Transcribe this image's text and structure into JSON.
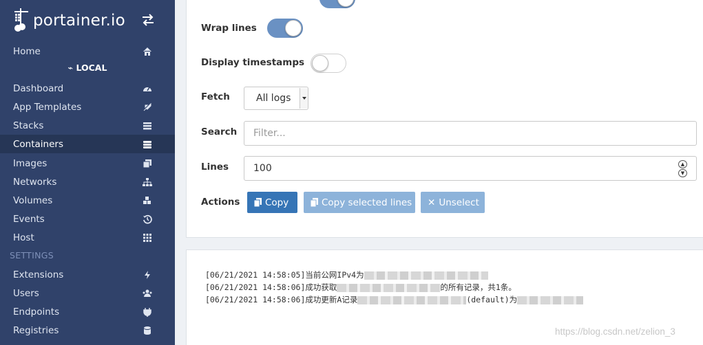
{
  "app": {
    "name": "portainer.io"
  },
  "sidebar": {
    "home": "Home",
    "endpoint": "LOCAL",
    "items": [
      {
        "label": "Dashboard",
        "icon": "tachometer-icon"
      },
      {
        "label": "App Templates",
        "icon": "rocket-icon"
      },
      {
        "label": "Stacks",
        "icon": "list-icon"
      },
      {
        "label": "Containers",
        "icon": "server-icon",
        "active": true
      },
      {
        "label": "Images",
        "icon": "clone-icon"
      },
      {
        "label": "Networks",
        "icon": "sitemap-icon"
      },
      {
        "label": "Volumes",
        "icon": "cubes-icon"
      },
      {
        "label": "Events",
        "icon": "history-icon"
      },
      {
        "label": "Host",
        "icon": "th-icon"
      }
    ],
    "settings_heading": "SETTINGS",
    "settings_items": [
      {
        "label": "Extensions",
        "icon": "bolt-icon"
      },
      {
        "label": "Users",
        "icon": "users-icon"
      },
      {
        "label": "Endpoints",
        "icon": "plug-icon"
      },
      {
        "label": "Registries",
        "icon": "database-icon"
      }
    ]
  },
  "log_settings": {
    "wrap_lines": {
      "label": "Wrap lines",
      "enabled": true
    },
    "display_timestamps": {
      "label": "Display timestamps",
      "enabled": false
    },
    "fetch": {
      "label": "Fetch",
      "value": "All logs"
    },
    "search": {
      "label": "Search",
      "placeholder": "Filter..."
    },
    "lines": {
      "label": "Lines",
      "value": "100"
    },
    "actions": {
      "label": "Actions",
      "copy": "Copy",
      "copy_selected": "Copy selected lines",
      "unselect": "Unselect"
    }
  },
  "logs": [
    {
      "prefix": "[06/21/2021 14:58:05]当前公网IPv4为",
      "suffix": ""
    },
    {
      "prefix": "[06/21/2021 14:58:06]成功获取",
      "suffix": "的所有记录，共1条。"
    },
    {
      "prefix": "[06/21/2021 14:58:06]成功更新A记录",
      "middle": "(default)为",
      "suffix": ""
    }
  ],
  "watermark": "https://blog.csdn.net/zelion_3",
  "colors": {
    "sidebar_bg": "#30426a",
    "primary": "#3675b6",
    "toggle_on": "#6a91c3"
  }
}
